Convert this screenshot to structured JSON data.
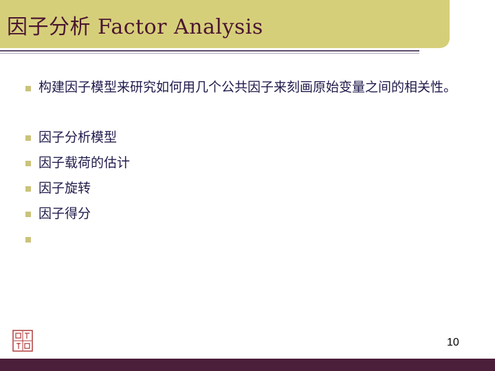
{
  "slide": {
    "title": "因子分析 Factor Analysis",
    "page_number": "10",
    "bullets": [
      "构建因子模型来研究如何用几个公共因子来刻画原始变量之间的相关性。",
      "因子分析模型",
      "因子载荷的估计",
      "因子旋转",
      "因子得分",
      ""
    ]
  },
  "colors": {
    "title_bar": "#d6cf7a",
    "title_text": "#4b1630",
    "bullet_marker": "#cbc37a",
    "bottom_bar": "#4b1f39",
    "seal": "#b23a3a"
  },
  "icons": {
    "seal": "red-seal-stamp"
  }
}
